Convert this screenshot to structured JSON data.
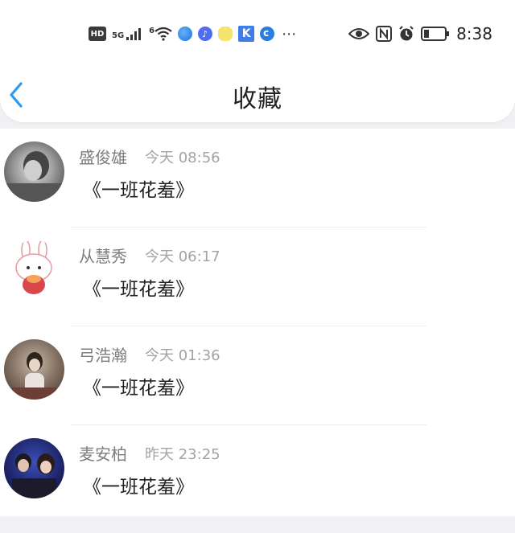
{
  "status_bar": {
    "network_badge": "HD",
    "signal_label": "5G",
    "wifi_label": "6",
    "more_icon": "⋯",
    "time": "8:38",
    "icons": [
      "hd-icon",
      "signal-icon",
      "wifi-icon",
      "app-icon",
      "music-icon",
      "weather-icon",
      "k-app-icon",
      "c-app-icon",
      "more-icon",
      "eye-icon",
      "nfc-icon",
      "alarm-icon",
      "battery-icon"
    ]
  },
  "header": {
    "title": "收藏",
    "back_icon": "chevron-left-icon",
    "accent_color": "#2b9af3"
  },
  "favorites": [
    {
      "name": "盛俊雄",
      "time": "今天 08:56",
      "title": "《一班花羞》",
      "avatar": "avatar-black-white-photo"
    },
    {
      "name": "从慧秀",
      "time": "今天 06:17",
      "title": "《一班花羞》",
      "avatar": "avatar-bunny-cartoon"
    },
    {
      "name": "弓浩瀚",
      "time": "今天 01:36",
      "title": "《一班花羞》",
      "avatar": "avatar-girl-photo"
    },
    {
      "name": "麦安柏",
      "time": "昨天 23:25",
      "title": "《一班花羞》",
      "avatar": "avatar-couple-photo"
    }
  ]
}
